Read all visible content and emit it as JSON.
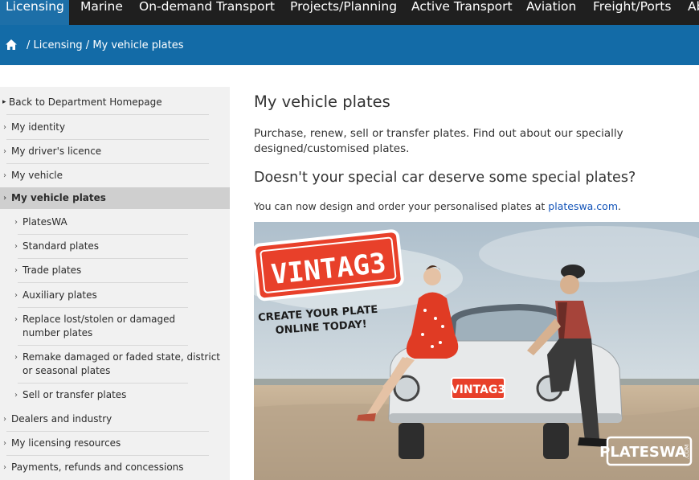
{
  "topnav": {
    "tabs": [
      {
        "label": "Licensing"
      },
      {
        "label": "Marine"
      },
      {
        "label": "On-demand Transport"
      },
      {
        "label": "Projects/Planning"
      },
      {
        "label": "Active Transport"
      },
      {
        "label": "Aviation"
      },
      {
        "label": "Freight/Ports"
      },
      {
        "label": "Ab"
      }
    ]
  },
  "breadcrumb": {
    "sep1": "/",
    "licensing": "Licensing",
    "sep2": "/",
    "current": "My vehicle plates"
  },
  "sidebar": {
    "back": "Back to Department Homepage",
    "items": [
      {
        "label": "My identity"
      },
      {
        "label": "My driver's licence"
      },
      {
        "label": "My vehicle"
      },
      {
        "label": "My vehicle plates"
      },
      {
        "label": "PlatesWA"
      },
      {
        "label": "Standard plates"
      },
      {
        "label": "Trade plates"
      },
      {
        "label": "Auxiliary plates"
      },
      {
        "label": "Replace lost/stolen or damaged number plates"
      },
      {
        "label": "Remake damaged or faded state, district or seasonal plates"
      },
      {
        "label": "Sell or transfer plates"
      },
      {
        "label": "Dealers and industry"
      },
      {
        "label": "My licensing resources"
      },
      {
        "label": "Payments, refunds and concessions"
      }
    ]
  },
  "main": {
    "title": "My vehicle plates",
    "intro": "Purchase, renew, sell or transfer plates. Find out about our specially designed/customised plates.",
    "subheading": "Doesn't your special car deserve some special plates?",
    "order_text": "You can now design and order your personalised plates at ",
    "order_link": "plateswa.com",
    "order_end": "."
  },
  "promo": {
    "plate_text": "VINTAG3",
    "tagline_1": "CREATE YOUR PLATE",
    "tagline_2": "ONLINE TODAY!",
    "car_plate": "VINTAG3",
    "brand": "PLATESWA",
    "brand_suffix": ".COM"
  },
  "colors": {
    "nav_bg": "#1f1f1f",
    "active_tab": "#1d6fa8",
    "crumb_bar": "#136ba7",
    "sidebar_bg": "#f1f1f1",
    "link": "#1253b8",
    "plate_red": "#e8402a"
  }
}
